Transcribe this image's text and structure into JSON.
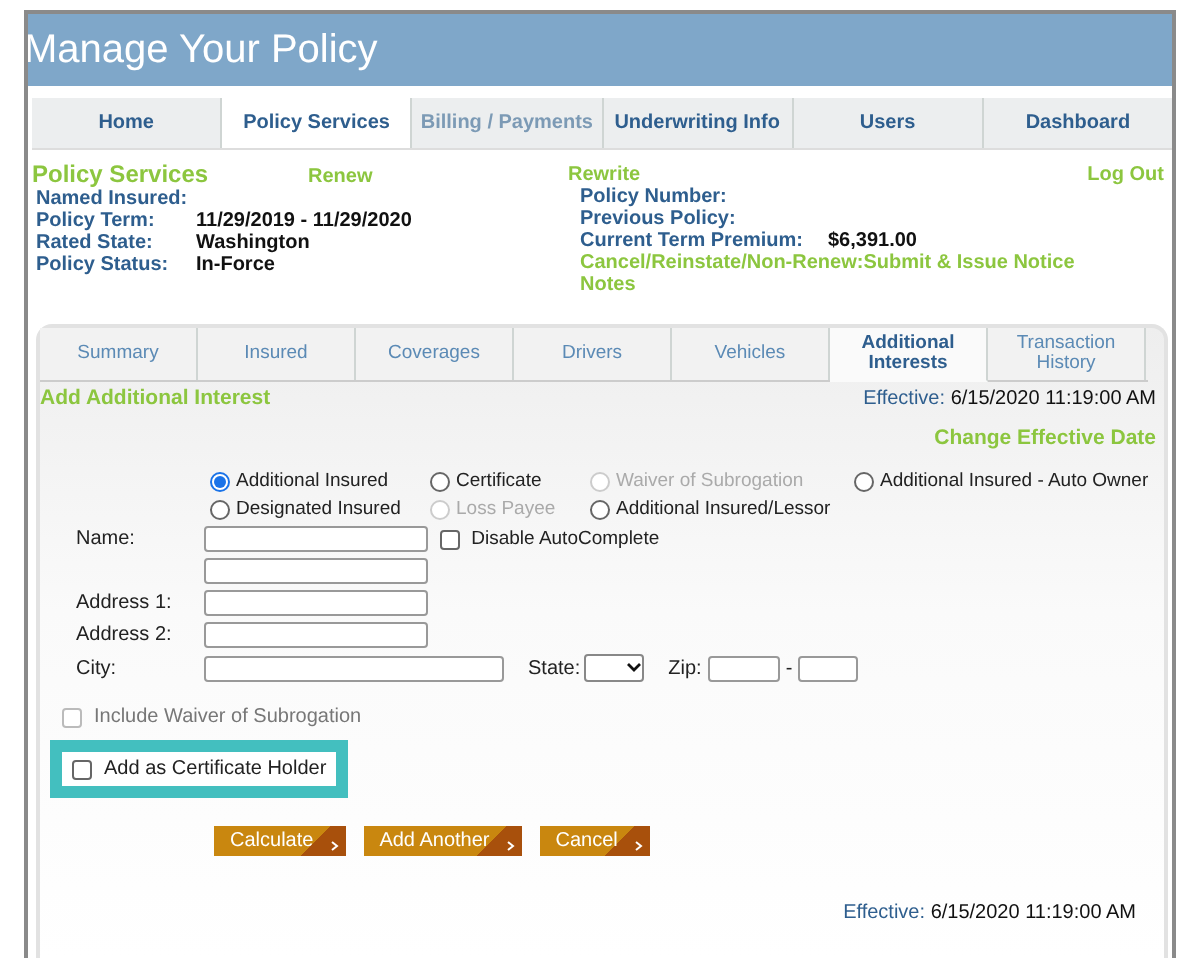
{
  "header": {
    "title": "Manage Your Policy"
  },
  "main_tabs": [
    {
      "label": "Home",
      "selected": false,
      "disabled": false
    },
    {
      "label": "Policy Services",
      "selected": true,
      "disabled": false
    },
    {
      "label": "Billing / Payments",
      "selected": false,
      "disabled": true
    },
    {
      "label": "Underwriting Info",
      "selected": false,
      "disabled": false
    },
    {
      "label": "Users",
      "selected": false,
      "disabled": false
    },
    {
      "label": "Dashboard",
      "selected": false,
      "disabled": false
    }
  ],
  "summary": {
    "section_title": "Policy Services",
    "renew_link": "Renew",
    "rewrite_link": "Rewrite",
    "logout_link": "Log Out",
    "left_fields": [
      {
        "label": "Named Insured:"
      },
      {
        "label": "Policy Term:",
        "value": "11/29/2019 - 11/29/2020"
      },
      {
        "label": "Rated State:",
        "value": "Washington"
      },
      {
        "label": "Policy Status:",
        "value": "In-Force"
      }
    ],
    "right_fields": [
      {
        "label": "Policy Number:"
      },
      {
        "label": "Previous Policy:"
      },
      {
        "label": "Current Term Premium:",
        "value": "$6,391.00"
      }
    ],
    "right_links": [
      "Cancel/Reinstate/Non-Renew:Submit & Issue Notice",
      "Notes"
    ]
  },
  "sub_tabs": [
    {
      "label": "Summary",
      "selected": false
    },
    {
      "label": "Insured",
      "selected": false
    },
    {
      "label": "Coverages",
      "selected": false
    },
    {
      "label": "Drivers",
      "selected": false
    },
    {
      "label": "Vehicles",
      "selected": false
    },
    {
      "label": "Additional Interests",
      "selected": true
    },
    {
      "label": "Transaction History",
      "selected": false
    }
  ],
  "form": {
    "title": "Add Additional Interest",
    "effective_label": "Effective:",
    "effective_value": "6/15/2020 11:19:00 AM",
    "change_date_link": "Change Effective Date",
    "interest_type_rows": [
      [
        {
          "label": "Additional Insured",
          "selected": true,
          "disabled": false
        },
        {
          "label": "Certificate",
          "selected": false,
          "disabled": false
        },
        {
          "label": "Waiver of Subrogation",
          "selected": false,
          "disabled": true
        },
        {
          "label": "Additional Insured - Auto Owner",
          "selected": false,
          "disabled": false
        }
      ],
      [
        {
          "label": "Designated Insured",
          "selected": false,
          "disabled": false
        },
        {
          "label": "Loss Payee",
          "selected": false,
          "disabled": true
        },
        {
          "label": "Additional Insured/Lessor",
          "selected": false,
          "disabled": false
        }
      ]
    ],
    "name_label": "Name:",
    "disable_autocomplete": {
      "label": "Disable AutoComplete",
      "checked": false
    },
    "address1_label": "Address 1:",
    "address2_label": "Address 2:",
    "city_label": "City:",
    "state_label": "State:",
    "zip_label": "Zip:",
    "zip_separator": "-",
    "options": [
      {
        "label": "Include Waiver of Subrogation",
        "checked": false,
        "disabled": true,
        "highlighted": false
      },
      {
        "label": "Add as Certificate Holder",
        "checked": false,
        "disabled": false,
        "highlighted": true
      }
    ],
    "buttons": [
      "Calculate",
      "Add Another",
      "Cancel"
    ],
    "footer_effective_label": "Effective:",
    "footer_effective_value": "6/15/2020 11:19:00 AM"
  }
}
